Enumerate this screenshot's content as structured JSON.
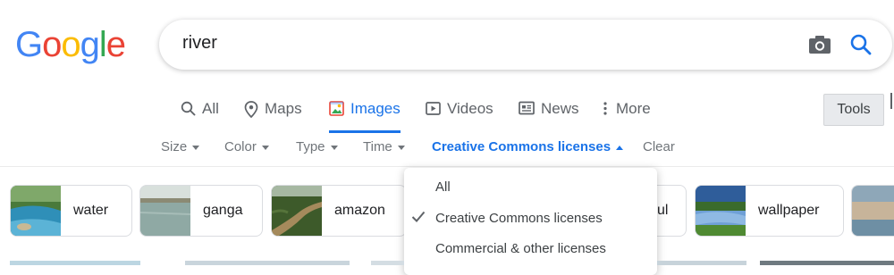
{
  "logo": {
    "letters": [
      "G",
      "o",
      "o",
      "g",
      "l",
      "e"
    ],
    "colors": [
      "#4285f4",
      "#ea4335",
      "#fbbc05",
      "#4285f4",
      "#34a853",
      "#ea4335"
    ]
  },
  "search": {
    "query": "river"
  },
  "tabs": [
    {
      "label": "All",
      "icon": "search-icon"
    },
    {
      "label": "Maps",
      "icon": "map-pin-icon"
    },
    {
      "label": "Images",
      "icon": "image-icon",
      "active": true
    },
    {
      "label": "Videos",
      "icon": "play-icon"
    },
    {
      "label": "News",
      "icon": "newspaper-icon"
    },
    {
      "label": "More",
      "icon": "more-vertical-icon"
    }
  ],
  "tools_label": "Tools",
  "filters": [
    {
      "label": "Size"
    },
    {
      "label": "Color"
    },
    {
      "label": "Type"
    },
    {
      "label": "Time"
    },
    {
      "label": "Creative Commons licenses",
      "active": true
    },
    {
      "label": "Clear"
    }
  ],
  "chips": [
    {
      "label": "water"
    },
    {
      "label": "ganga"
    },
    {
      "label": "amazon"
    },
    {
      "label": "ul"
    },
    {
      "label": "wallpaper"
    }
  ],
  "dropdown": {
    "items": [
      {
        "label": "All"
      },
      {
        "label": "Creative Commons licenses",
        "selected": true
      },
      {
        "label": "Commercial & other licenses"
      }
    ]
  },
  "colors": {
    "accent": "#1a73e8",
    "text_muted": "#5f6368"
  }
}
